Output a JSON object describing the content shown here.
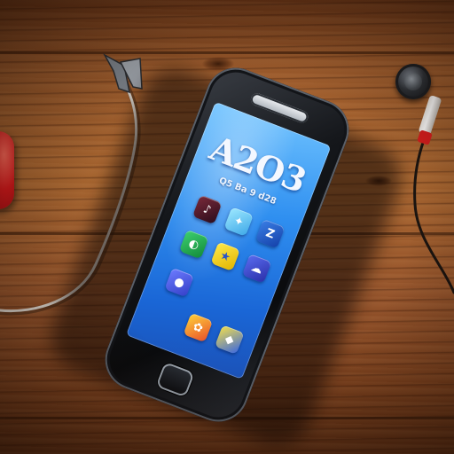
{
  "scene": {
    "description_tags": [
      "smartphone",
      "wooden-table",
      "earphone-cable",
      "audio-jack",
      "round-knob",
      "red-object"
    ],
    "colors": {
      "wood": "#9c5a2b",
      "phone_body": "#15171b",
      "screen": "#2f8ff0",
      "cable": "#d9d4cc",
      "red_object": "#d8191c"
    }
  },
  "phone": {
    "screen": {
      "clock_text": "A2O3",
      "subtitle_text": "Q5 Ba 9 d28"
    },
    "app_icons": [
      {
        "name": "app-icon-1",
        "glyph": "♪"
      },
      {
        "name": "app-icon-2",
        "glyph": "✦"
      },
      {
        "name": "app-icon-3",
        "glyph": "Z"
      },
      {
        "name": "app-icon-4",
        "glyph": "◐"
      },
      {
        "name": "app-icon-5",
        "glyph": "★"
      },
      {
        "name": "app-icon-6",
        "glyph": "☁"
      },
      {
        "name": "app-icon-7",
        "glyph": "●"
      },
      {
        "name": "app-icon-8",
        "glyph": "✿"
      },
      {
        "name": "app-icon-9",
        "glyph": "◆"
      }
    ]
  }
}
